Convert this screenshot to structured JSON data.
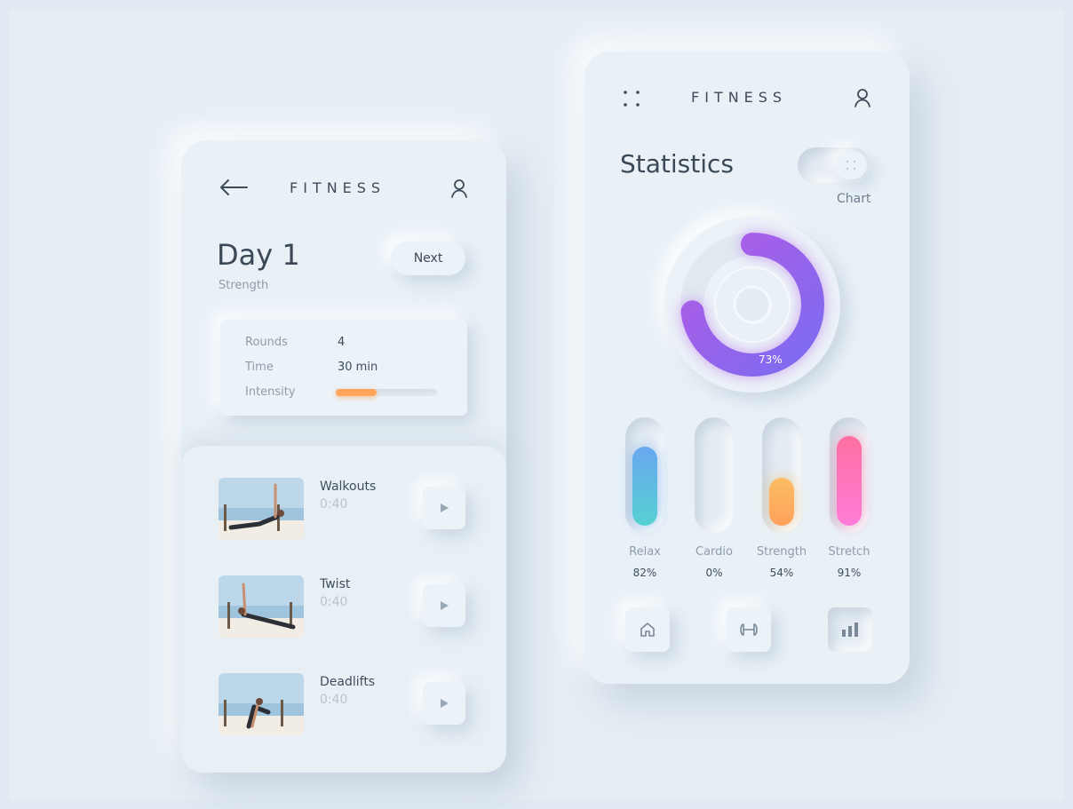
{
  "left_card": {
    "brand": "FITNESS",
    "title": "Day 1",
    "subtitle": "Strength",
    "next_label": "Next",
    "stats": {
      "rounds_label": "Rounds",
      "rounds_value": "4",
      "time_label": "Time",
      "time_value": "30 min",
      "intensity_label": "Intensity",
      "intensity_level": 0.4
    },
    "exercises": [
      {
        "name": "Walkouts",
        "duration": "0:40"
      },
      {
        "name": "Twist",
        "duration": "0:40"
      },
      {
        "name": "Deadlifts",
        "duration": "0:40"
      }
    ]
  },
  "right_card": {
    "brand": "FITNESS",
    "title": "Statistics",
    "toggle_label": "Chart",
    "donut_label": "73%",
    "donut_value": 73,
    "bars": [
      {
        "name": "Relax",
        "value_label": "82%",
        "level": 0.82,
        "color_top": "#6aa7f0",
        "color_bottom": "#55d2d2"
      },
      {
        "name": "Cardio",
        "value_label": "0%",
        "level": 0,
        "color_top": "#dfe8f0",
        "color_bottom": "#dfe8f0"
      },
      {
        "name": "Strength",
        "value_label": "54%",
        "level": 0.54,
        "color_top": "#fbbd63",
        "color_bottom": "#ffa15c"
      },
      {
        "name": "Stretch",
        "value_label": "91%",
        "level": 0.91,
        "color_top": "#ff6fa1",
        "color_bottom": "#ff7dd8"
      }
    ],
    "nav": [
      "home-icon",
      "dumbbell-icon",
      "bar-chart-icon"
    ]
  },
  "colors": {
    "donut_start": "#7b6cf0",
    "donut_end": "#b25be6",
    "intensity_bar": "#ffa65c"
  }
}
